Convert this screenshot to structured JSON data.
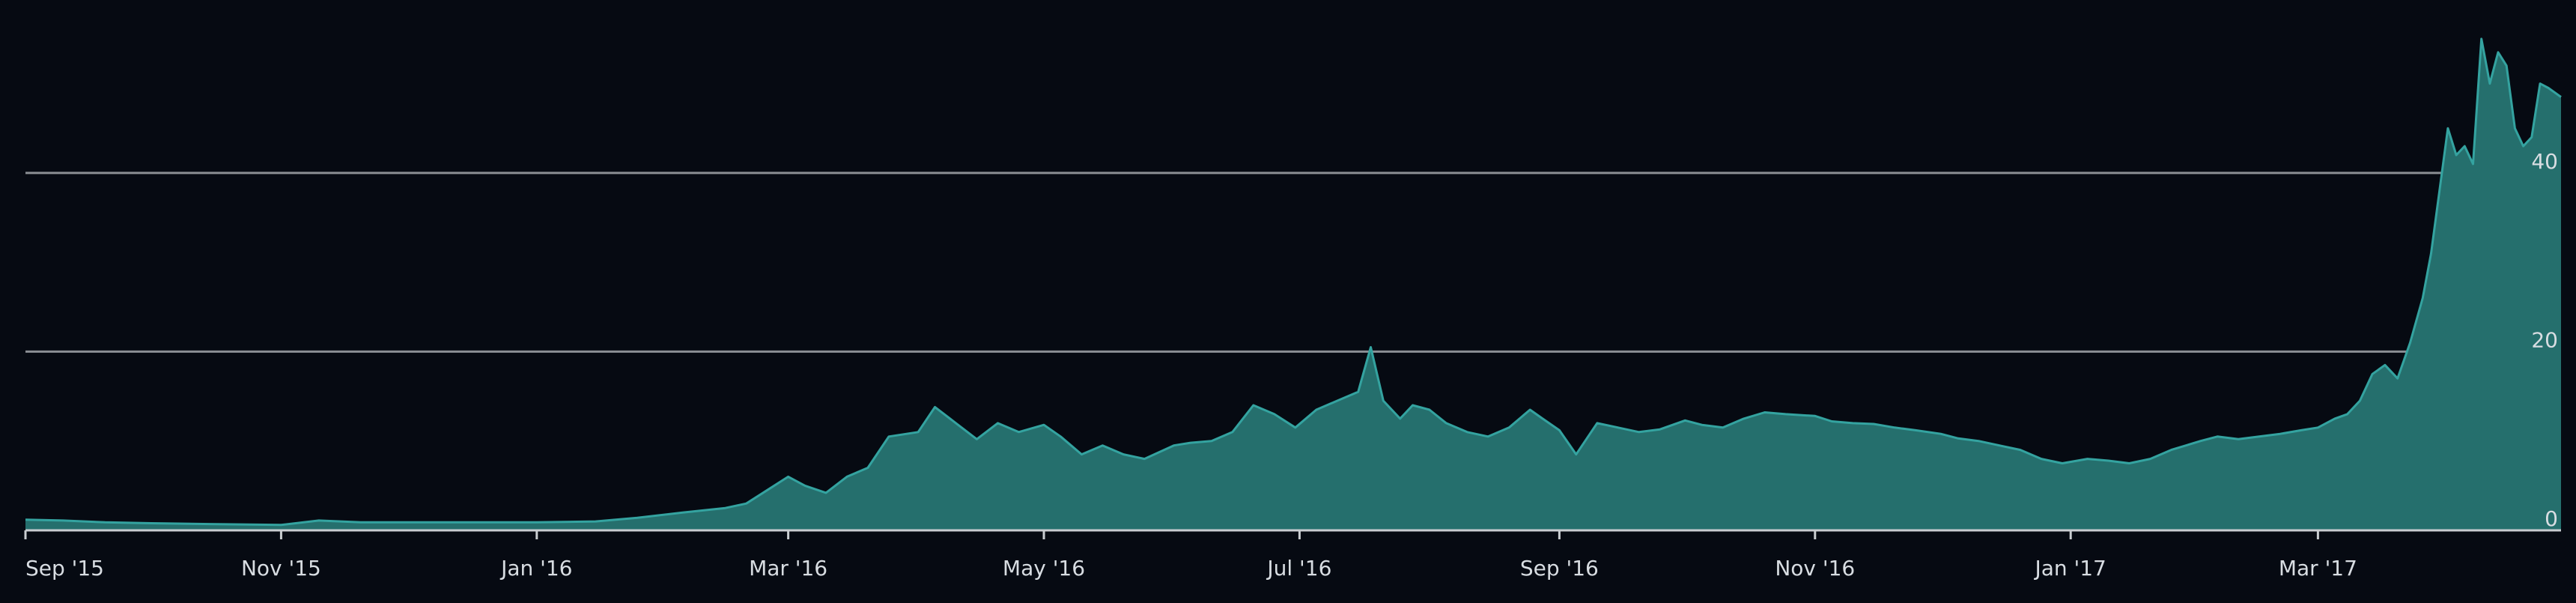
{
  "chart_data": {
    "type": "area",
    "title": "",
    "xlabel": "",
    "ylabel": "",
    "x_ticks": [
      "Sep '15",
      "Nov '15",
      "Jan '16",
      "Mar '16",
      "May '16",
      "Jul '16",
      "Sep '16",
      "Nov '16",
      "Jan '17",
      "Mar '17"
    ],
    "y_ticks": [
      "0",
      "20",
      "40"
    ],
    "x_range": [
      "2015-09-01",
      "2017-04-28"
    ],
    "ylim": [
      0,
      56
    ],
    "grid": "horizontal",
    "colors": {
      "background": "#060a12",
      "area_fill": "#256f6d",
      "line": "#34a3a0",
      "grid": "#8b8f94",
      "text": "#d8dde2"
    },
    "series": [
      {
        "points": [
          [
            "2015-09-01",
            1.2
          ],
          [
            "2015-09-10",
            1.1
          ],
          [
            "2015-09-20",
            0.9
          ],
          [
            "2015-10-01",
            0.8
          ],
          [
            "2015-10-15",
            0.7
          ],
          [
            "2015-11-01",
            0.6
          ],
          [
            "2015-11-10",
            1.1
          ],
          [
            "2015-11-20",
            0.9
          ],
          [
            "2015-12-01",
            0.9
          ],
          [
            "2015-12-15",
            0.9
          ],
          [
            "2016-01-01",
            0.9
          ],
          [
            "2016-01-15",
            1.0
          ],
          [
            "2016-01-25",
            1.4
          ],
          [
            "2016-02-05",
            2.0
          ],
          [
            "2016-02-15",
            2.5
          ],
          [
            "2016-02-20",
            3.0
          ],
          [
            "2016-02-25",
            4.5
          ],
          [
            "2016-03-01",
            6.0
          ],
          [
            "2016-03-05",
            5.0
          ],
          [
            "2016-03-10",
            4.2
          ],
          [
            "2016-03-15",
            6.0
          ],
          [
            "2016-03-20",
            7.0
          ],
          [
            "2016-03-25",
            10.5
          ],
          [
            "2016-04-01",
            11.0
          ],
          [
            "2016-04-05",
            13.8
          ],
          [
            "2016-04-10",
            12.0
          ],
          [
            "2016-04-15",
            10.2
          ],
          [
            "2016-04-20",
            12.0
          ],
          [
            "2016-04-25",
            11.0
          ],
          [
            "2016-05-01",
            11.8
          ],
          [
            "2016-05-05",
            10.5
          ],
          [
            "2016-05-10",
            8.5
          ],
          [
            "2016-05-15",
            9.5
          ],
          [
            "2016-05-20",
            8.5
          ],
          [
            "2016-05-25",
            8.0
          ],
          [
            "2016-06-01",
            9.5
          ],
          [
            "2016-06-05",
            9.8
          ],
          [
            "2016-06-10",
            10.0
          ],
          [
            "2016-06-15",
            11.0
          ],
          [
            "2016-06-20",
            14.0
          ],
          [
            "2016-06-25",
            13.0
          ],
          [
            "2016-06-30",
            11.5
          ],
          [
            "2016-07-05",
            13.5
          ],
          [
            "2016-07-10",
            14.5
          ],
          [
            "2016-07-15",
            15.5
          ],
          [
            "2016-07-18",
            20.5
          ],
          [
            "2016-07-21",
            14.5
          ],
          [
            "2016-07-25",
            12.5
          ],
          [
            "2016-07-28",
            14.0
          ],
          [
            "2016-08-01",
            13.5
          ],
          [
            "2016-08-05",
            12.0
          ],
          [
            "2016-08-10",
            11.0
          ],
          [
            "2016-08-15",
            10.5
          ],
          [
            "2016-08-20",
            11.5
          ],
          [
            "2016-08-25",
            13.5
          ],
          [
            "2016-08-28",
            12.5
          ],
          [
            "2016-09-01",
            11.2
          ],
          [
            "2016-09-05",
            8.5
          ],
          [
            "2016-09-10",
            12.0
          ],
          [
            "2016-09-15",
            11.5
          ],
          [
            "2016-09-20",
            11.0
          ],
          [
            "2016-09-25",
            11.3
          ],
          [
            "2016-10-01",
            12.3
          ],
          [
            "2016-10-05",
            11.8
          ],
          [
            "2016-10-10",
            11.5
          ],
          [
            "2016-10-15",
            12.5
          ],
          [
            "2016-10-20",
            13.2
          ],
          [
            "2016-10-25",
            13.0
          ],
          [
            "2016-11-01",
            12.8
          ],
          [
            "2016-11-05",
            12.2
          ],
          [
            "2016-11-10",
            12.0
          ],
          [
            "2016-11-15",
            11.9
          ],
          [
            "2016-11-20",
            11.5
          ],
          [
            "2016-11-25",
            11.2
          ],
          [
            "2016-12-01",
            10.8
          ],
          [
            "2016-12-05",
            10.3
          ],
          [
            "2016-12-10",
            10.0
          ],
          [
            "2016-12-15",
            9.5
          ],
          [
            "2016-12-20",
            9.0
          ],
          [
            "2016-12-25",
            8.0
          ],
          [
            "2016-12-30",
            7.5
          ],
          [
            "2017-01-05",
            8.0
          ],
          [
            "2017-01-10",
            7.8
          ],
          [
            "2017-01-15",
            7.5
          ],
          [
            "2017-01-20",
            8.0
          ],
          [
            "2017-01-25",
            9.0
          ],
          [
            "2017-02-01",
            10.0
          ],
          [
            "2017-02-05",
            10.5
          ],
          [
            "2017-02-10",
            10.2
          ],
          [
            "2017-02-15",
            10.5
          ],
          [
            "2017-02-20",
            10.8
          ],
          [
            "2017-02-25",
            11.2
          ],
          [
            "2017-03-01",
            11.5
          ],
          [
            "2017-03-05",
            12.5
          ],
          [
            "2017-03-08",
            13.0
          ],
          [
            "2017-03-11",
            14.5
          ],
          [
            "2017-03-14",
            17.5
          ],
          [
            "2017-03-17",
            18.5
          ],
          [
            "2017-03-20",
            17.0
          ],
          [
            "2017-03-23",
            21.0
          ],
          [
            "2017-03-26",
            26.0
          ],
          [
            "2017-03-28",
            31.0
          ],
          [
            "2017-03-30",
            38.0
          ],
          [
            "2017-04-01",
            45.0
          ],
          [
            "2017-04-03",
            42.0
          ],
          [
            "2017-04-05",
            43.0
          ],
          [
            "2017-04-07",
            41.0
          ],
          [
            "2017-04-09",
            55.0
          ],
          [
            "2017-04-11",
            50.0
          ],
          [
            "2017-04-13",
            53.5
          ],
          [
            "2017-04-15",
            52.0
          ],
          [
            "2017-04-17",
            45.0
          ],
          [
            "2017-04-19",
            43.0
          ],
          [
            "2017-04-21",
            44.0
          ],
          [
            "2017-04-23",
            50.0
          ],
          [
            "2017-04-25",
            49.5
          ],
          [
            "2017-04-28",
            48.5
          ]
        ]
      }
    ]
  }
}
